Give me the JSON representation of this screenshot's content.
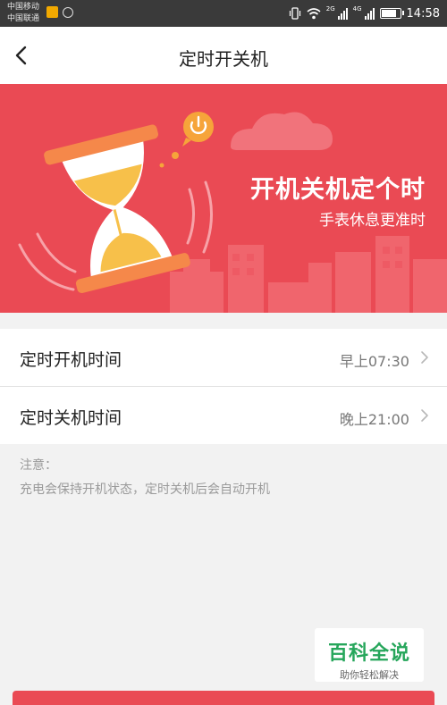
{
  "status_bar": {
    "carrier1": "中国移动",
    "carrier2": "中国联通",
    "net1": "2G",
    "net2": "4G",
    "time": "14:58"
  },
  "header": {
    "title": "定时开关机"
  },
  "banner": {
    "title": "开机关机定个时",
    "subtitle": "手表休息更准时",
    "background_color": "#ea4a54"
  },
  "settings": [
    {
      "label": "定时开机时间",
      "value": "早上07:30"
    },
    {
      "label": "定时关机时间",
      "value": "晚上21:00"
    }
  ],
  "notice": {
    "heading": "注意：",
    "text": "充电会保持开机状态，定时关机后会自动开机"
  },
  "watermark": {
    "title": "百科全说",
    "subtitle": "助你轻松解决"
  },
  "icons": [
    "back-arrow-icon",
    "power-icon",
    "hourglass-illustration",
    "chevron-right-icon",
    "wifi-icon",
    "battery-icon"
  ],
  "colors": {
    "accent": "#ea4a54",
    "watermark_green": "#26a65b"
  }
}
